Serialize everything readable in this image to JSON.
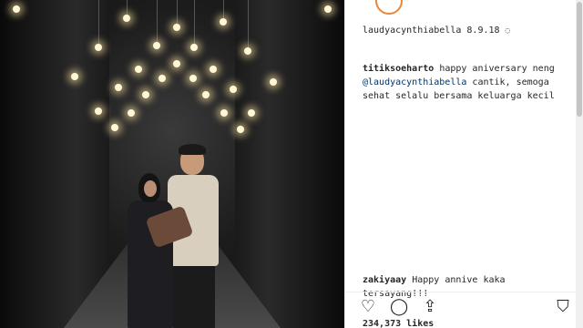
{
  "post": {
    "author": "laudyacynthiabella",
    "date": "8.9.18",
    "likes": "234,373 likes"
  },
  "comments": [
    {
      "user": "titiksoeharto",
      "text_before": "happy aniversary neng",
      "mention": "@laudyacynthiabella",
      "text_after": "cantik, semoga sehat selalu bersama keluarga kecil"
    },
    {
      "user": "zakiyaay",
      "text": "Happy annive kaka tersayang!!!"
    }
  ],
  "icons": {
    "like": "heart-icon",
    "comment": "comment-icon",
    "share": "share-icon",
    "save": "bookmark-icon"
  },
  "colors": {
    "story_ring": "#e8873a",
    "mention": "#003569",
    "text": "#262626"
  }
}
